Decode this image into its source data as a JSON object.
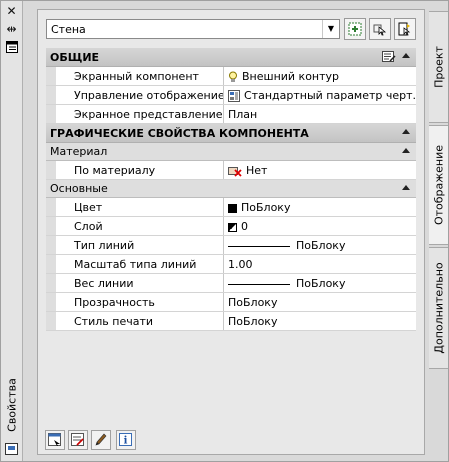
{
  "palette": {
    "title": "Свойства"
  },
  "selection": {
    "value": "Стена"
  },
  "tabs": [
    {
      "label": "Проект"
    },
    {
      "label": "Отображение"
    },
    {
      "label": "Дополнительно"
    }
  ],
  "sections": {
    "general": {
      "title": "ОБЩИЕ",
      "rows": [
        {
          "name": "Экранный компонент",
          "value": "Внешний контур",
          "icon": "lightbulb-icon"
        },
        {
          "name": "Управление отображением",
          "value": "Стандартный параметр черт...",
          "icon": "display-control-icon"
        },
        {
          "name": "Экранное представление",
          "value": "План"
        }
      ]
    },
    "graphic": {
      "title": "ГРАФИЧЕСКИЕ СВОЙСТВА КОМПОНЕНТА"
    },
    "material": {
      "title": "Материал",
      "rows": [
        {
          "name": "По материалу",
          "value": "Нет",
          "icon": "no-material-icon"
        }
      ]
    },
    "basic": {
      "title": "Основные",
      "rows": [
        {
          "name": "Цвет",
          "value": "ПоБлоку"
        },
        {
          "name": "Слой",
          "value": "0"
        },
        {
          "name": "Тип линий",
          "value": "ПоБлоку"
        },
        {
          "name": "Масштаб типа линий",
          "value": "1.00"
        },
        {
          "name": "Вес линии",
          "value": "ПоБлоку"
        },
        {
          "name": "Прозрачность",
          "value": "ПоБлоку"
        },
        {
          "name": "Стиль печати",
          "value": "ПоБлоку"
        }
      ]
    }
  }
}
